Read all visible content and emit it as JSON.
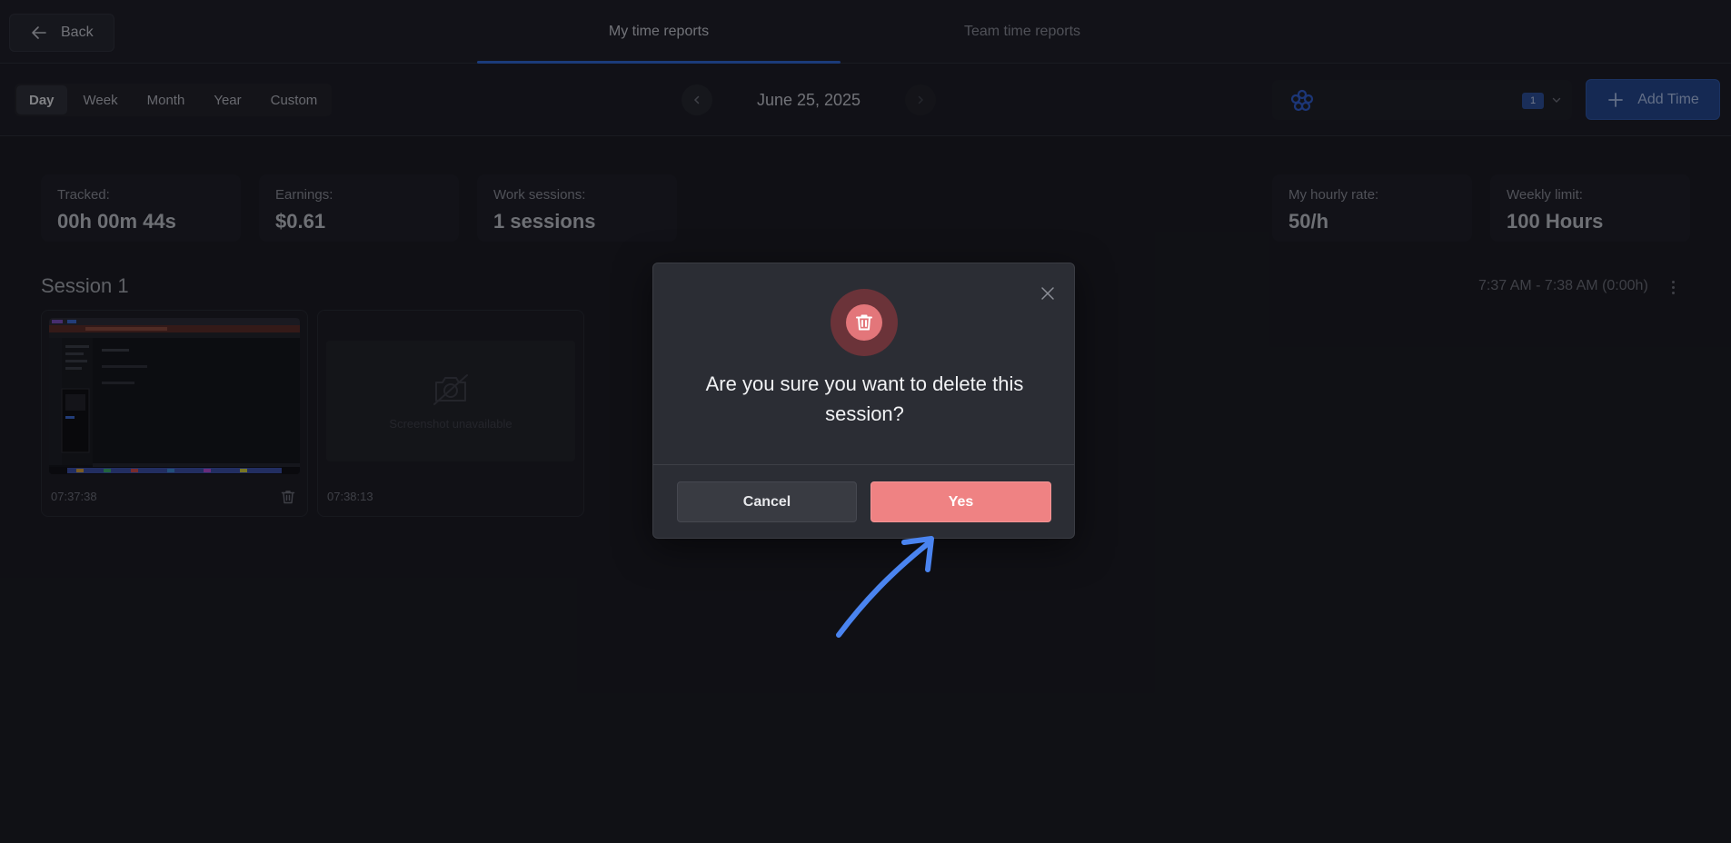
{
  "header": {
    "back_label": "Back",
    "tabs": [
      {
        "label": "My time reports",
        "active": true
      },
      {
        "label": "Team time reports",
        "active": false
      }
    ]
  },
  "toolbar": {
    "ranges": [
      {
        "label": "Day",
        "active": true
      },
      {
        "label": "Week",
        "active": false
      },
      {
        "label": "Month",
        "active": false
      },
      {
        "label": "Year",
        "active": false
      },
      {
        "label": "Custom",
        "active": false
      }
    ],
    "date": "June 25, 2025",
    "team_badge": "1",
    "add_time_label": "Add Time"
  },
  "stats": {
    "tracked": {
      "label": "Tracked:",
      "value": "00h 00m 44s"
    },
    "earnings": {
      "label": "Earnings:",
      "value": "$0.61"
    },
    "sessions": {
      "label": "Work sessions:",
      "value": "1 sessions"
    },
    "hourly_rate": {
      "label": "My hourly rate:",
      "value": "50/h"
    },
    "weekly_limit": {
      "label": "Weekly limit:",
      "value": "100 Hours"
    }
  },
  "session": {
    "title": "Session 1",
    "time_range": "7:37 AM - 7:38 AM (0:00h)",
    "screenshots": [
      {
        "time": "07:37:38",
        "available": true
      },
      {
        "time": "07:38:13",
        "available": false,
        "unavailable_text": "Screenshot unavailable"
      }
    ]
  },
  "modal": {
    "question": "Are you sure you want to delete this session?",
    "cancel_label": "Cancel",
    "confirm_label": "Yes"
  },
  "colors": {
    "accent": "#2d67d6",
    "danger": "#ef8283",
    "annotation_arrow": "#4a84f0"
  }
}
